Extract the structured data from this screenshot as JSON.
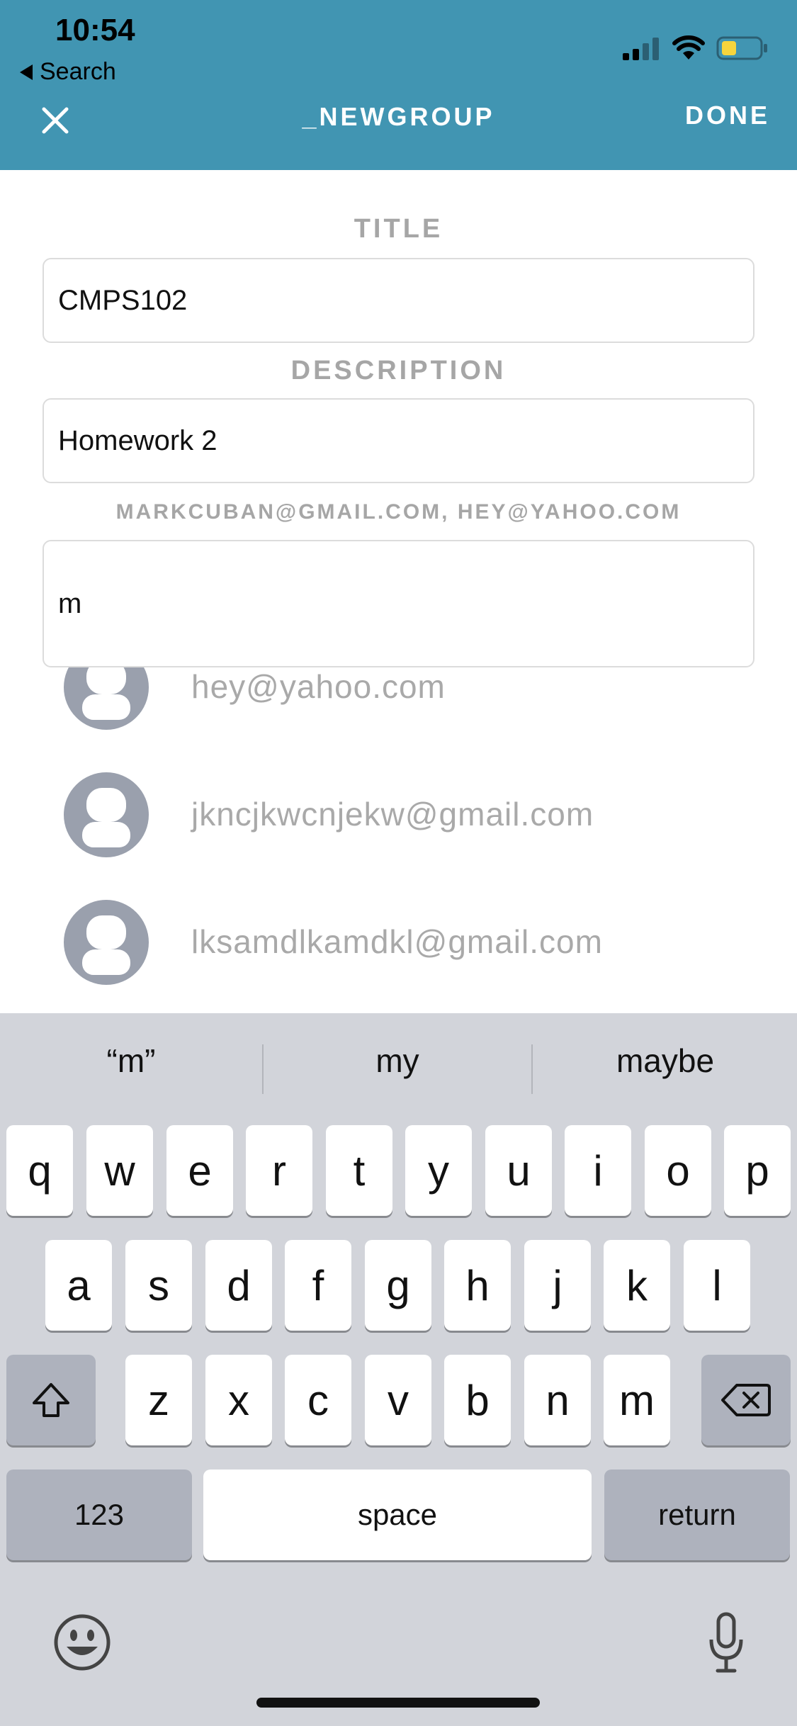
{
  "status_bar": {
    "time": "10:54",
    "back_label": "Search"
  },
  "header": {
    "title": "_NEWGROUP",
    "done_label": "DONE"
  },
  "form": {
    "title_label": "TITLE",
    "title_value": "CMPS102",
    "description_label": "DESCRIPTION",
    "description_value": "Homework 2",
    "members_label": "MARKCUBAN@GMAIL.COM, HEY@YAHOO.COM",
    "members_input_value": "m"
  },
  "suggestions": [
    {
      "email": "hey@yahoo.com"
    },
    {
      "email": "jkncjkwcnjekw@gmail.com"
    },
    {
      "email": "lksamdlkamdkl@gmail.com"
    }
  ],
  "keyboard": {
    "predictions": [
      "“m”",
      "my",
      "maybe"
    ],
    "row1": [
      "q",
      "w",
      "e",
      "r",
      "t",
      "y",
      "u",
      "i",
      "o",
      "p"
    ],
    "row2": [
      "a",
      "s",
      "d",
      "f",
      "g",
      "h",
      "j",
      "k",
      "l"
    ],
    "row3": [
      "z",
      "x",
      "c",
      "v",
      "b",
      "n",
      "m"
    ],
    "numbers_label": "123",
    "space_label": "space",
    "return_label": "return"
  },
  "colors": {
    "header_bg": "#4195B2",
    "keyboard_bg": "#d2d4da",
    "avatar": "#9aa0ad"
  }
}
